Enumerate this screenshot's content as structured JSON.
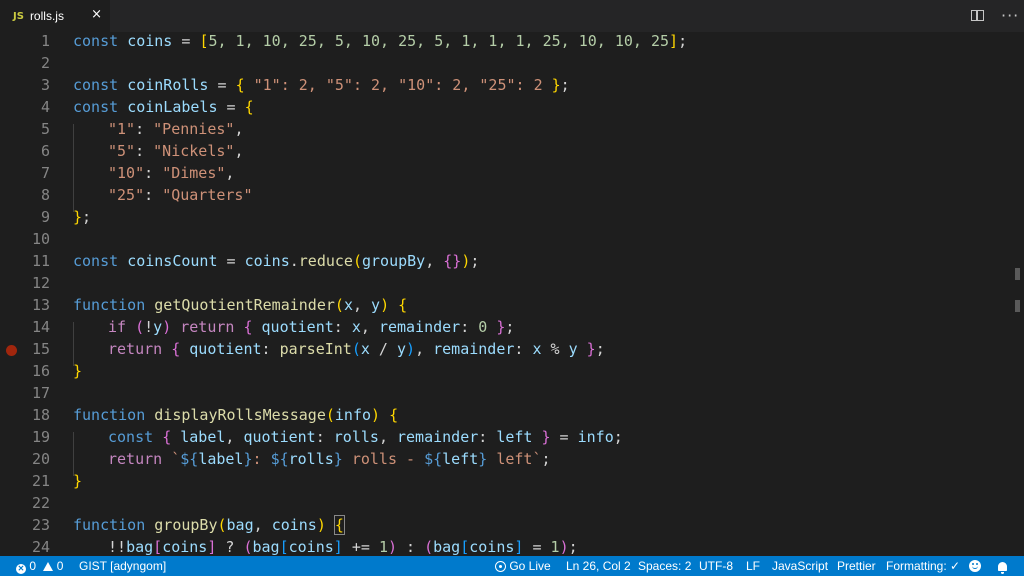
{
  "tab": {
    "lang_badge": "JS",
    "filename": "rolls.js",
    "close": "×"
  },
  "toolbar": {
    "more": "···"
  },
  "status": {
    "errors": "0",
    "warnings": "0",
    "gist": "GIST [adyngom]",
    "go_live": "Go Live",
    "position": "Ln 26, Col 2",
    "spaces": "Spaces: 2",
    "encoding": "UTF-8",
    "eol": "LF",
    "language": "JavaScript",
    "formatter": "Prettier",
    "formatting": "Formatting: ✓"
  },
  "colors": {
    "statusbar": "#007acc",
    "editor_bg": "#1e1e1e",
    "tabbar": "#252526",
    "breakpoint": "#a1260d"
  },
  "line_numbers": [
    "1",
    "2",
    "3",
    "4",
    "5",
    "6",
    "7",
    "8",
    "9",
    "10",
    "11",
    "12",
    "13",
    "14",
    "15",
    "16",
    "17",
    "18",
    "19",
    "20",
    "21",
    "22",
    "23",
    "24"
  ],
  "code": {
    "l1": {
      "kw": "const",
      "name": "coins",
      "eq": " = ",
      "open": "[",
      "values": "5, 1, 10, 25, 5, 10, 25, 5, 1, 1, 1, 25, 10, 10, 25",
      "close": "]",
      "end": ";"
    },
    "l3": {
      "kw": "const",
      "name": "coinRolls",
      "eq": " = ",
      "open": "{",
      "body": " \"1\": 2, \"5\": 2, \"10\": 2, \"25\": 2 ",
      "close": "}",
      "end": ";"
    },
    "l4": {
      "kw": "const",
      "name": "coinLabels",
      "eq": " = ",
      "open": "{"
    },
    "l5": {
      "key": "\"1\"",
      "colon": ": ",
      "val": "\"Pennies\"",
      "comma": ","
    },
    "l6": {
      "key": "\"5\"",
      "colon": ": ",
      "val": "\"Nickels\"",
      "comma": ","
    },
    "l7": {
      "key": "\"10\"",
      "colon": ": ",
      "val": "\"Dimes\"",
      "comma": ","
    },
    "l8": {
      "key": "\"25\"",
      "colon": ": ",
      "val": "\"Quarters\""
    },
    "l9": {
      "close": "}",
      "end": ";"
    },
    "l11": {
      "kw": "const",
      "name": "coinsCount",
      "eq": " = ",
      "obj": "coins",
      "dot": ".",
      "fn": "reduce",
      "open": "(",
      "arg": "groupBy",
      "comma": ", ",
      "inner": "{}",
      "close": ")",
      "end": ";"
    },
    "l13": {
      "kw": "function",
      "fn": "getQuotientRemainder",
      "open": "(",
      "p1": "x",
      "comma": ", ",
      "p2": "y",
      "close": ")",
      "brace": "{"
    },
    "l14": {
      "kw": "if",
      "open": "(",
      "neg": "!",
      "y": "y",
      "close": ")",
      "ret": "return",
      "ob": "{",
      "q": "quotient",
      "c1": ": ",
      "x": "x",
      "c2": ", ",
      "r": "remainder",
      "c3": ": ",
      "zero": "0",
      "cb": "}",
      "end": ";"
    },
    "l15": {
      "ret": "return",
      "ob": "{",
      "q": "quotient",
      "c1": ": ",
      "fn": "parseInt",
      "open": "(",
      "x": "x",
      "div": " / ",
      "y": "y",
      "close": ")",
      "c2": ", ",
      "r": "remainder",
      "c3": ": ",
      "x2": "x",
      "mod": " % ",
      "y2": "y",
      "cb": "}",
      "end": ";"
    },
    "l16": {
      "close": "}"
    },
    "l18": {
      "kw": "function",
      "fn": "displayRollsMessage",
      "open": "(",
      "p": "info",
      "close": ")",
      "brace": "{"
    },
    "l19": {
      "kw": "const",
      "ob": "{",
      "a": "label",
      "c1": ", ",
      "b": "quotient",
      "c2": ": ",
      "c": "rolls",
      "c3": ", ",
      "d": "remainder",
      "c4": ": ",
      "e": "left",
      "cb": "}",
      "eq": " = ",
      "src": "info",
      "end": ";"
    },
    "l20": {
      "ret": "return",
      "t1": "`",
      "i1o": "${",
      "i1": "label",
      "i1c": "}",
      "t2": ": ",
      "i2o": "${",
      "i2": "rolls",
      "i2c": "}",
      "t3": " rolls - ",
      "i3o": "${",
      "i3": "left",
      "i3c": "}",
      "t4": " left`",
      "end": ";"
    },
    "l21": {
      "close": "}"
    },
    "l23": {
      "kw": "function",
      "fn": "groupBy",
      "open": "(",
      "p1": "bag",
      "comma": ", ",
      "p2": "coins",
      "close": ")",
      "brace": "{"
    },
    "l24": {
      "neg": "!!",
      "bag": "bag",
      "ob": "[",
      "coins": "coins",
      "cb": "]",
      "tern": " ? ",
      "po": "(",
      "bag2": "bag",
      "ob2": "[",
      "coins2": "coins",
      "cb2": "]",
      "pe": " += ",
      "one": "1",
      "pc": ")",
      "colon": " : ",
      "po2": "(",
      "bag3": "bag",
      "ob3": "[",
      "coins3": "coins",
      "cb3": "]",
      "asg": " = ",
      "one2": "1",
      "pc2": ")",
      "end": ";"
    }
  }
}
